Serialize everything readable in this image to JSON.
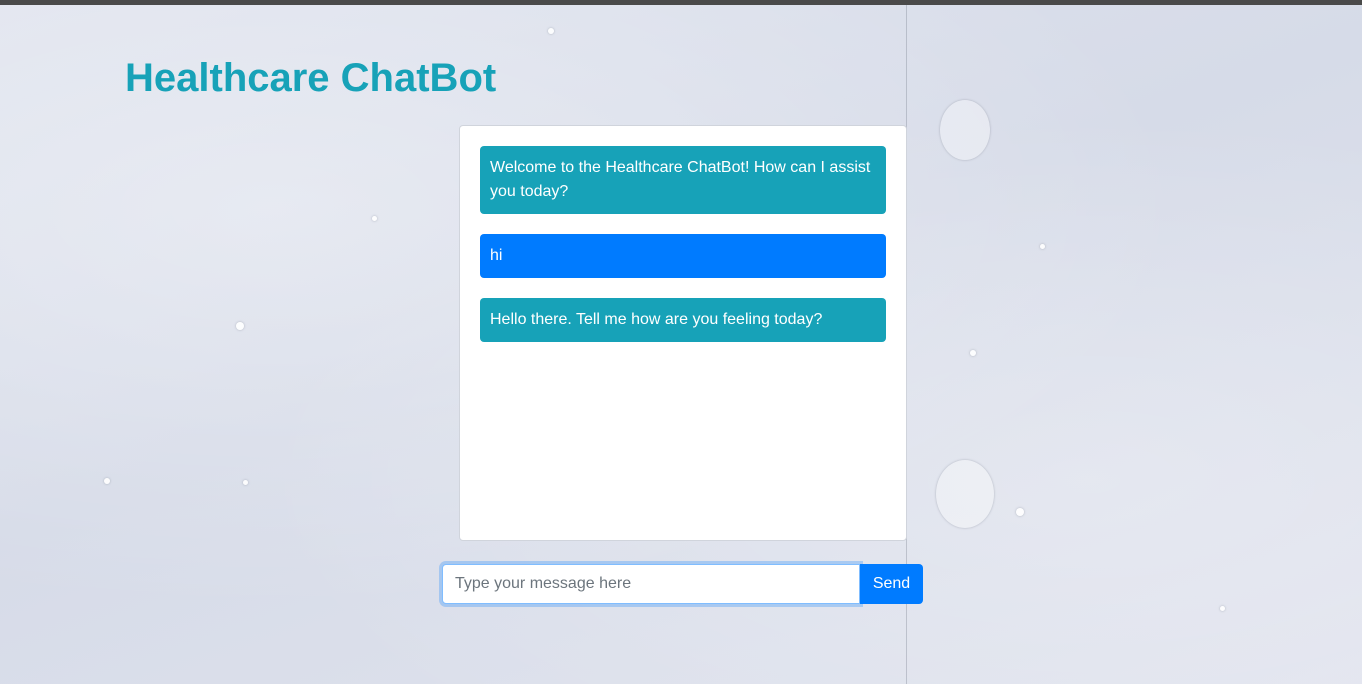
{
  "page": {
    "title": "Healthcare ChatBot"
  },
  "chat": {
    "messages": [
      {
        "sender": "bot",
        "text": "Welcome to the Healthcare ChatBot! How can I assist you today?"
      },
      {
        "sender": "user",
        "text": "hi"
      },
      {
        "sender": "bot",
        "text": "Hello there. Tell me how are you feeling today?"
      }
    ]
  },
  "composer": {
    "placeholder": "Type your message here",
    "value": "",
    "send_label": "Send"
  },
  "colors": {
    "title": "#17a2b8",
    "bot_bubble": "#17a2b8",
    "user_bubble": "#007bff",
    "send_button": "#007bff"
  }
}
